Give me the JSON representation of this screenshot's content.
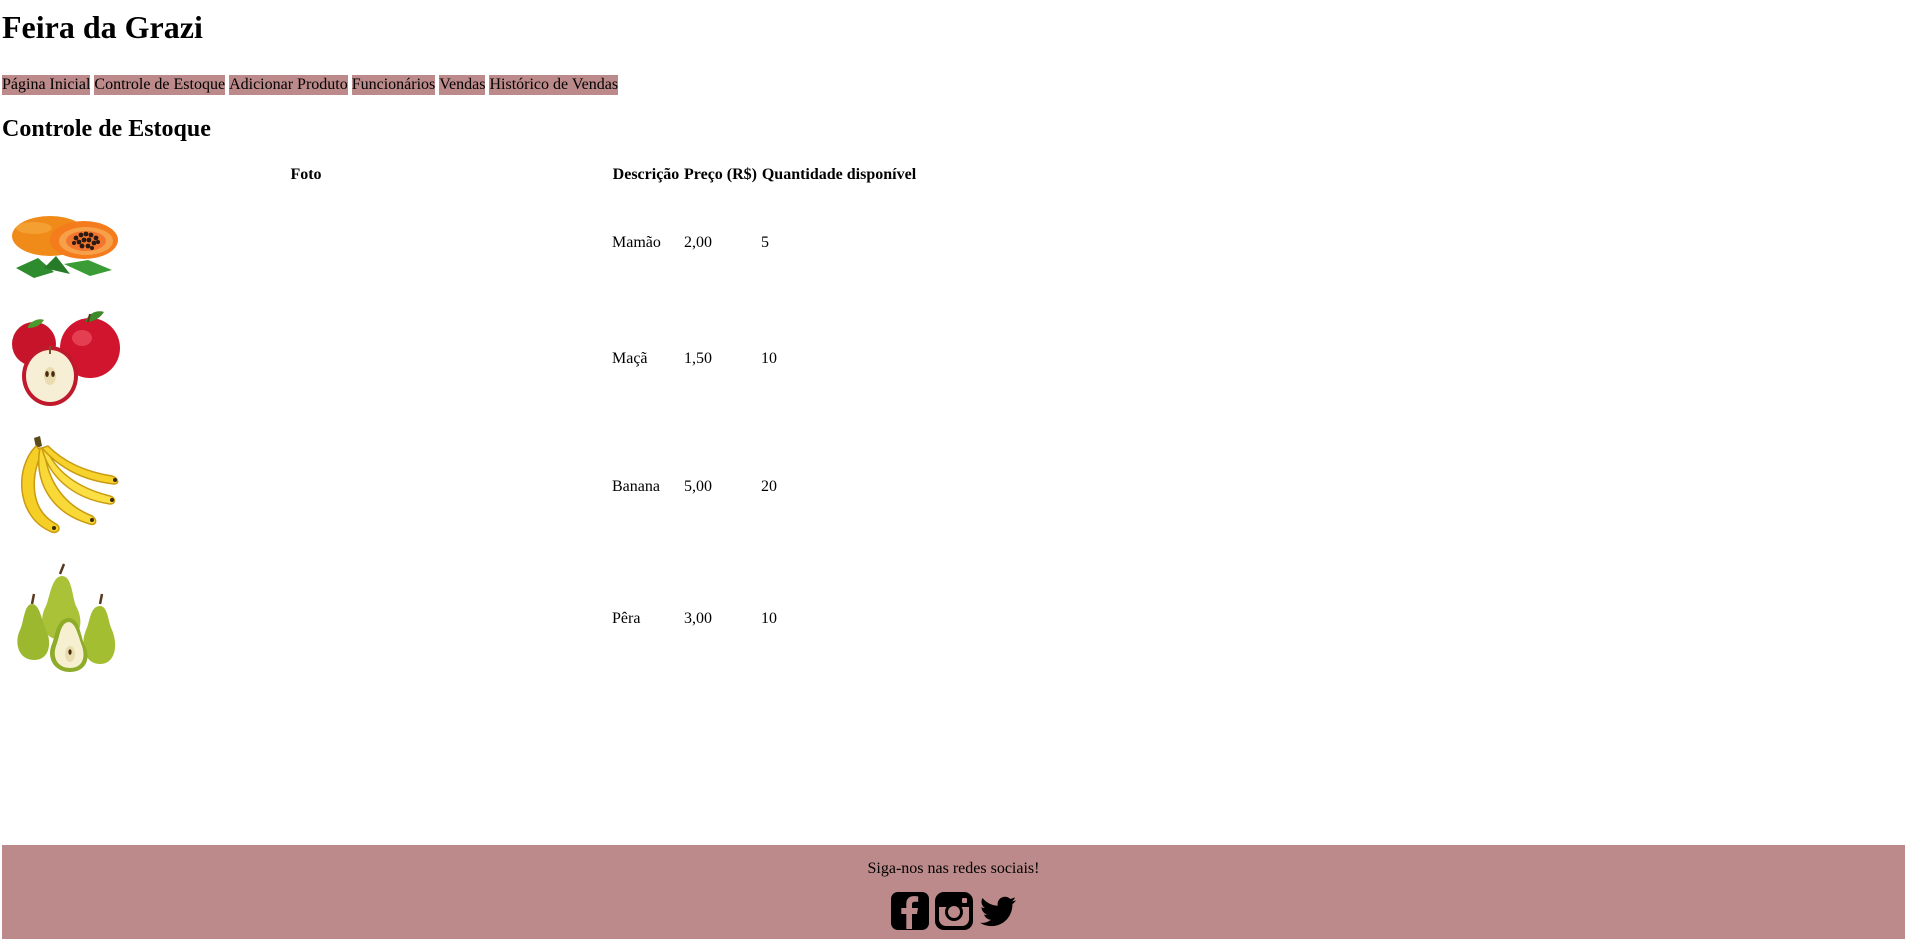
{
  "header": {
    "title": "Feira da Grazi"
  },
  "nav": {
    "items": [
      {
        "label": "Página Inicial"
      },
      {
        "label": "Controle de Estoque"
      },
      {
        "label": "Adicionar Produto"
      },
      {
        "label": "Funcionários"
      },
      {
        "label": "Vendas"
      },
      {
        "label": "Histórico de Vendas"
      }
    ],
    "background_color": "#bc8a8a"
  },
  "main": {
    "section_title": "Controle de Estoque",
    "table": {
      "columns": [
        "Foto",
        "Descrição",
        "Preço (R$)",
        "Quantidade disponível"
      ],
      "rows": [
        {
          "photo_icon": "papaya-image",
          "description": "Mamão",
          "price": "2,00",
          "quantity": "5"
        },
        {
          "photo_icon": "apple-image",
          "description": "Maçã",
          "price": "1,50",
          "quantity": "10"
        },
        {
          "photo_icon": "banana-image",
          "description": "Banana",
          "price": "5,00",
          "quantity": "20"
        },
        {
          "photo_icon": "pear-image",
          "description": "Pêra",
          "price": "3,00",
          "quantity": "10"
        }
      ]
    }
  },
  "footer": {
    "text": "Siga-nos nas redes sociais!",
    "background_color": "#bc8a8a",
    "social_icons": [
      "facebook-icon",
      "instagram-icon",
      "twitter-icon"
    ]
  }
}
